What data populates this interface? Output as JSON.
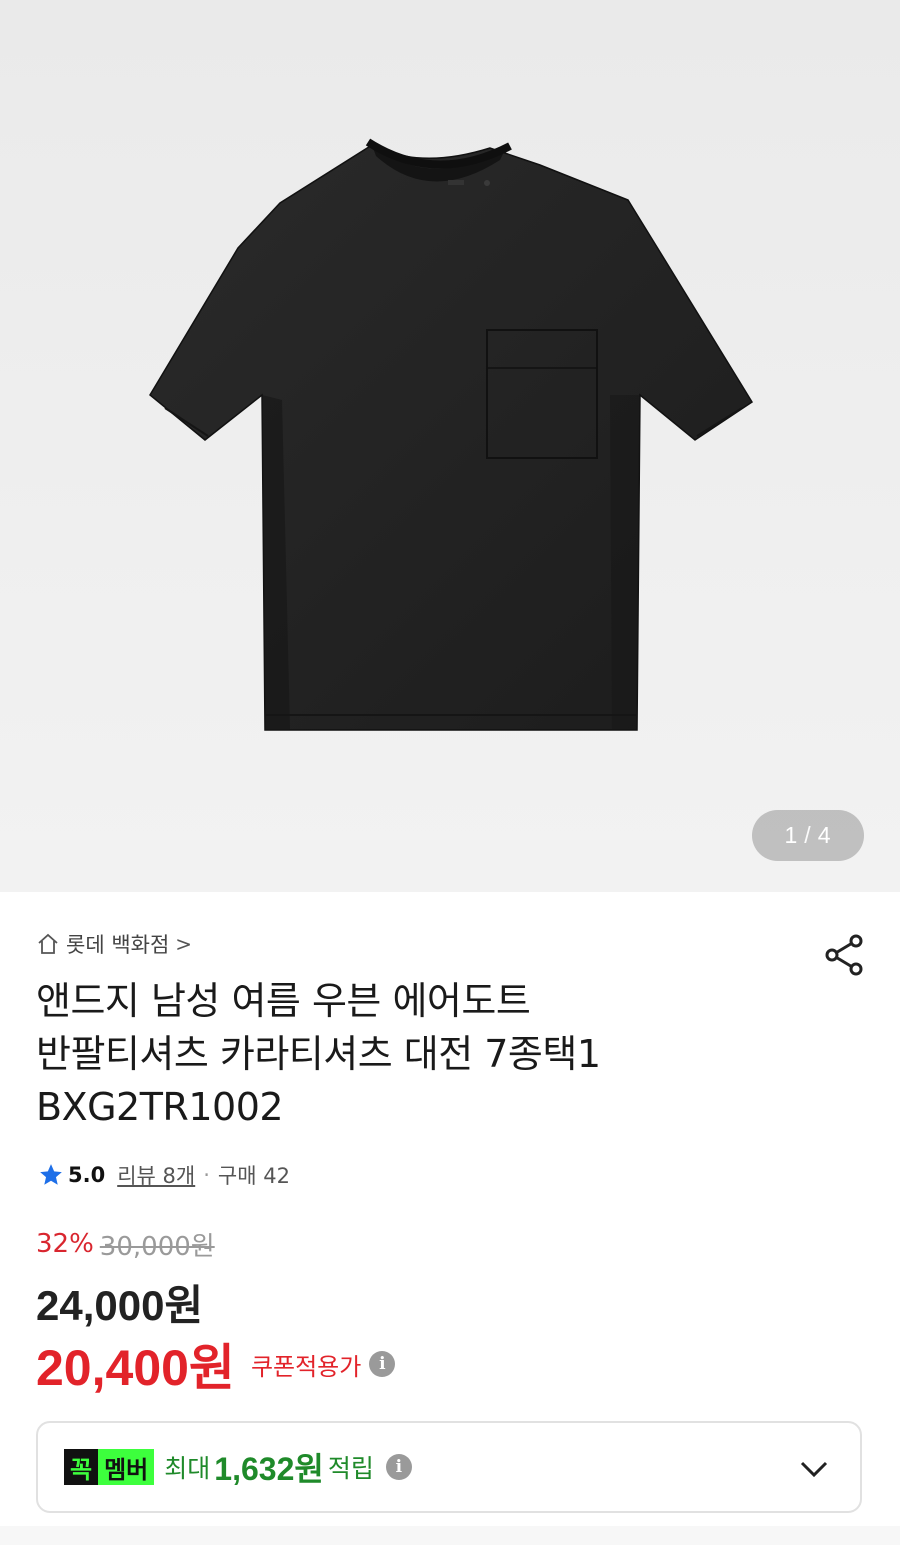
{
  "gallery": {
    "current": "1",
    "total": "4",
    "separator": "/"
  },
  "store": {
    "name": "롯데 백화점",
    "chevron": ">"
  },
  "product": {
    "title_lines": [
      "앤드지 남성 여름 우븐 에어도트",
      "반팔티셔츠 카라티셔츠 대전 7종택1",
      "BXG2TR1002"
    ]
  },
  "rating": {
    "score": "5.0",
    "review_label": "리뷰 8개",
    "dot": "·",
    "purchase_label": "구매 42"
  },
  "price": {
    "discount_pct": "32%",
    "original": "30,000원",
    "sale": "24,000원",
    "coupon_price": "20,400원",
    "coupon_label": "쿠폰적용가"
  },
  "membership": {
    "badge_part1": "꼭",
    "badge_part2": "멤버",
    "prefix": "최대",
    "amount": "1,632원",
    "suffix": "적립"
  },
  "colors": {
    "accent_red": "#e2232a",
    "member_green": "#1f8a2a",
    "badge_green": "#3dff3d",
    "star_blue": "#1e6fe8"
  }
}
